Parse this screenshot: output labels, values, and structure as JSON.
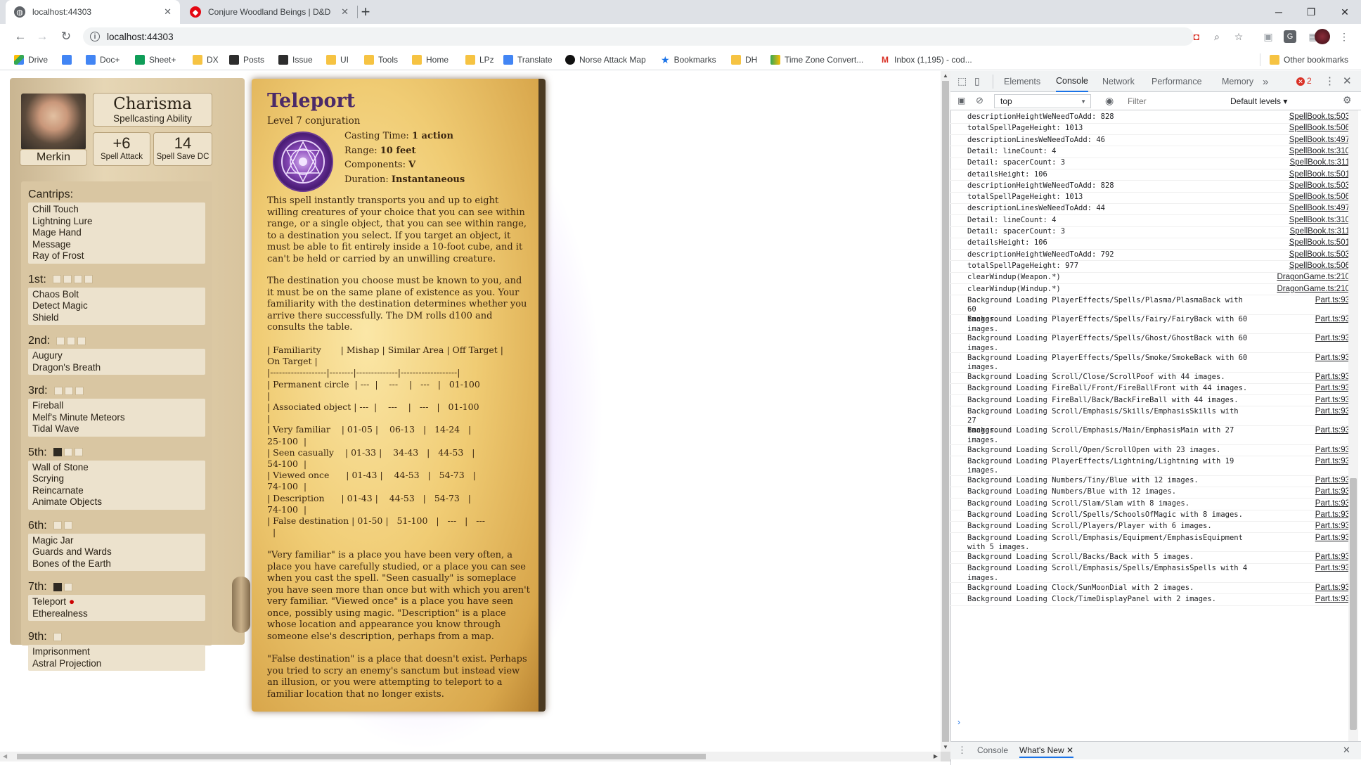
{
  "tabs": [
    {
      "title": "localhost:44303",
      "active": true
    },
    {
      "title": "Conjure Woodland Beings | D&D",
      "active": false
    }
  ],
  "window": {
    "minimize": "─",
    "restore": "❐",
    "close": "✕"
  },
  "omnibox": {
    "url": "localhost:44303"
  },
  "bookmarks": [
    "Drive",
    "Doc+",
    "Sheet+",
    "DX",
    "Posts",
    "Issue",
    "UI",
    "Tools",
    "Home",
    "LPz",
    "Translate",
    "Norse Attack Map",
    "Bookmarks",
    "DH",
    "Time Zone Convert...",
    "Inbox (1,195) - cod...",
    "Other bookmarks"
  ],
  "character": {
    "name": "Merkin",
    "ability": "Charisma",
    "ability_sub": "Spellcasting Ability",
    "spell_attack": "+6",
    "spell_attack_label": "Spell Attack",
    "save_dc": "14",
    "save_dc_label": "Spell Save DC"
  },
  "spell_levels": [
    {
      "label": "Cantrips:",
      "slots_total": 0,
      "slots_used": 0,
      "spells": [
        "Chill Touch",
        "Lightning Lure",
        "Mage Hand",
        "Message",
        "Ray of Frost"
      ]
    },
    {
      "label": "1st:",
      "slots_total": 4,
      "slots_used": 0,
      "spells": [
        "Chaos Bolt",
        "Detect Magic",
        "Shield"
      ]
    },
    {
      "label": "2nd:",
      "slots_total": 3,
      "slots_used": 0,
      "spells": [
        "Augury",
        "Dragon's Breath"
      ]
    },
    {
      "label": "3rd:",
      "slots_total": 3,
      "slots_used": 0,
      "spells": [
        "Fireball",
        "Melf's Minute Meteors",
        "Tidal Wave"
      ]
    },
    {
      "label": "5th:",
      "slots_total": 3,
      "slots_used": 1,
      "spells": [
        "Wall of Stone",
        "Scrying",
        "Reincarnate",
        "Animate Objects"
      ]
    },
    {
      "label": "6th:",
      "slots_total": 2,
      "slots_used": 0,
      "spells": [
        "Magic Jar",
        "Guards and Wards",
        "Bones of the Earth"
      ]
    },
    {
      "label": "7th:",
      "slots_total": 2,
      "slots_used": 1,
      "spells": [
        "Teleport",
        "Etherealness"
      ]
    },
    {
      "label": "9th:",
      "slots_total": 1,
      "slots_used": 0,
      "spells": [
        "Imprisonment",
        "Astral Projection"
      ]
    }
  ],
  "spell": {
    "name": "Teleport",
    "level_school": "Level 7 conjuration",
    "casting_time_label": "Casting Time:",
    "casting_time": "1 action",
    "range_label": "Range:",
    "range": "10 feet",
    "components_label": "Components:",
    "components": "V",
    "duration_label": "Duration:",
    "duration": "Instantaneous",
    "p1": "This spell instantly transports you and up to eight\nwilling creatures of your choice that you can see within\nrange, or a single object, that you can see within range,\nto a destination you select. If you target an object, it\nmust be able to fit entirely inside a 10-foot cube, and it\ncan't be held or carried by an unwilling creature.",
    "p2": "The destination you choose must be known to you, and\nit must be on the same plane of existence as you. Your\nfamiliarity with the destination determines whether you\narrive there successfully. The DM rolls d100 and\nconsults the table.",
    "table": "| Familiarity       | Mishap | Similar Area | Off Target |\nOn Target |\n|-------------------|--------|--------------|-------------------|\n| Permanent circle  | ---  |    ---    |   ---   |   01-100\n|\n| Associated object | ---  |    ---    |   ---   |   01-100\n|\n| Very familiar    | 01-05 |    06-13   |   14-24   |\n25-100  |\n| Seen casually    | 01-33 |    34-43   |   44-53   |\n54-100  |\n| Viewed once      | 01-43 |    44-53   |   54-73   |\n74-100  |\n| Description      | 01-43 |    44-53   |   54-73   |\n74-100  |\n| False destination | 01-50 |   51-100   |   ---   |   ---\n  |",
    "p3": "\"Very familiar\" is a place you have been very often, a\nplace you have carefully studied, or a place you can see\nwhen you cast the spell. \"Seen casually\" is someplace\nyou have seen more than once but with which you aren't\nvery familiar. \"Viewed once\" is a place you have seen\nonce, possibly using magic. \"Description\" is a place\nwhose location and appearance you know through\nsomeone else's description, perhaps from a map.",
    "p4": "\"False destination\" is a place that doesn't exist. Perhaps\nyou tried to scry an enemy's sanctum but instead view\nan illusion, or you were attempting to teleport to a\nfamiliar location that no longer exists."
  },
  "devtools": {
    "tabs": [
      "Elements",
      "Console",
      "Network",
      "Performance",
      "Memory"
    ],
    "active_tab": "Console",
    "more": "»",
    "error_count": "2",
    "context": "top",
    "filter_placeholder": "Filter",
    "levels": "Default levels ▾",
    "drawer_tabs": [
      "Console",
      "What's New"
    ],
    "logs": [
      {
        "text": "descriptionHeightWeNeedToAdd: 828",
        "src": "SpellBook.ts:503"
      },
      {
        "text": "totalSpellPageHeight: 1013",
        "src": "SpellBook.ts:506"
      },
      {
        "text": "descriptionLinesWeNeedToAdd: 46",
        "src": "SpellBook.ts:497"
      },
      {
        "text": "Detail: lineCount: 4",
        "src": "SpellBook.ts:310"
      },
      {
        "text": "Detail: spacerCount: 3",
        "src": "SpellBook.ts:311"
      },
      {
        "text": "detailsHeight: 106",
        "src": "SpellBook.ts:501"
      },
      {
        "text": "descriptionHeightWeNeedToAdd: 828",
        "src": "SpellBook.ts:503"
      },
      {
        "text": "totalSpellPageHeight: 1013",
        "src": "SpellBook.ts:506"
      },
      {
        "text": "descriptionLinesWeNeedToAdd: 44",
        "src": "SpellBook.ts:497"
      },
      {
        "text": "Detail: lineCount: 4",
        "src": "SpellBook.ts:310"
      },
      {
        "text": "Detail: spacerCount: 3",
        "src": "SpellBook.ts:311"
      },
      {
        "text": "detailsHeight: 106",
        "src": "SpellBook.ts:501"
      },
      {
        "text": "descriptionHeightWeNeedToAdd: 792",
        "src": "SpellBook.ts:503"
      },
      {
        "text": "totalSpellPageHeight: 977",
        "src": "SpellBook.ts:506"
      },
      {
        "text": "clearWindup(Weapon.*)",
        "src": "DragonGame.ts:210"
      },
      {
        "text": "clearWindup(Windup.*)",
        "src": "DragonGame.ts:210"
      },
      {
        "text": "Background Loading PlayerEffects/Spells/Plasma/PlasmaBack with 60\nimages.",
        "src": "Part.ts:93"
      },
      {
        "text": "Background Loading PlayerEffects/Spells/Fairy/FairyBack with 60\nimages.",
        "src": "Part.ts:93"
      },
      {
        "text": "Background Loading PlayerEffects/Spells/Ghost/GhostBack with 60\nimages.",
        "src": "Part.ts:93"
      },
      {
        "text": "Background Loading PlayerEffects/Spells/Smoke/SmokeBack with 60\nimages.",
        "src": "Part.ts:93"
      },
      {
        "text": "Background Loading Scroll/Close/ScrollPoof with 44 images.",
        "src": "Part.ts:93"
      },
      {
        "text": "Background Loading FireBall/Front/FireBallFront with 44 images.",
        "src": "Part.ts:93"
      },
      {
        "text": "Background Loading FireBall/Back/BackFireBall with 44 images.",
        "src": "Part.ts:93"
      },
      {
        "text": "Background Loading Scroll/Emphasis/Skills/EmphasisSkills with 27\nimages.",
        "src": "Part.ts:93"
      },
      {
        "text": "Background Loading Scroll/Emphasis/Main/EmphasisMain with 27\nimages.",
        "src": "Part.ts:93"
      },
      {
        "text": "Background Loading Scroll/Open/ScrollOpen with 23 images.",
        "src": "Part.ts:93"
      },
      {
        "text": "Background Loading PlayerEffects/Lightning/Lightning with 19\nimages.",
        "src": "Part.ts:93"
      },
      {
        "text": "Background Loading Numbers/Tiny/Blue with 12 images.",
        "src": "Part.ts:93"
      },
      {
        "text": "Background Loading Numbers/Blue with 12 images.",
        "src": "Part.ts:93"
      },
      {
        "text": "Background Loading Scroll/Slam/Slam with 8 images.",
        "src": "Part.ts:93"
      },
      {
        "text": "Background Loading Scroll/Spells/SchoolsOfMagic with 8 images.",
        "src": "Part.ts:93"
      },
      {
        "text": "Background Loading Scroll/Players/Player with 6 images.",
        "src": "Part.ts:93"
      },
      {
        "text": "Background Loading Scroll/Emphasis/Equipment/EmphasisEquipment\nwith 5 images.",
        "src": "Part.ts:93"
      },
      {
        "text": "Background Loading Scroll/Backs/Back with 5 images.",
        "src": "Part.ts:93"
      },
      {
        "text": "Background Loading Scroll/Emphasis/Spells/EmphasisSpells with 4\nimages.",
        "src": "Part.ts:93"
      },
      {
        "text": "Background Loading Clock/SunMoonDial with 2 images.",
        "src": "Part.ts:93"
      },
      {
        "text": "Background Loading Clock/TimeDisplayPanel with 2 images.",
        "src": "Part.ts:93"
      }
    ]
  }
}
